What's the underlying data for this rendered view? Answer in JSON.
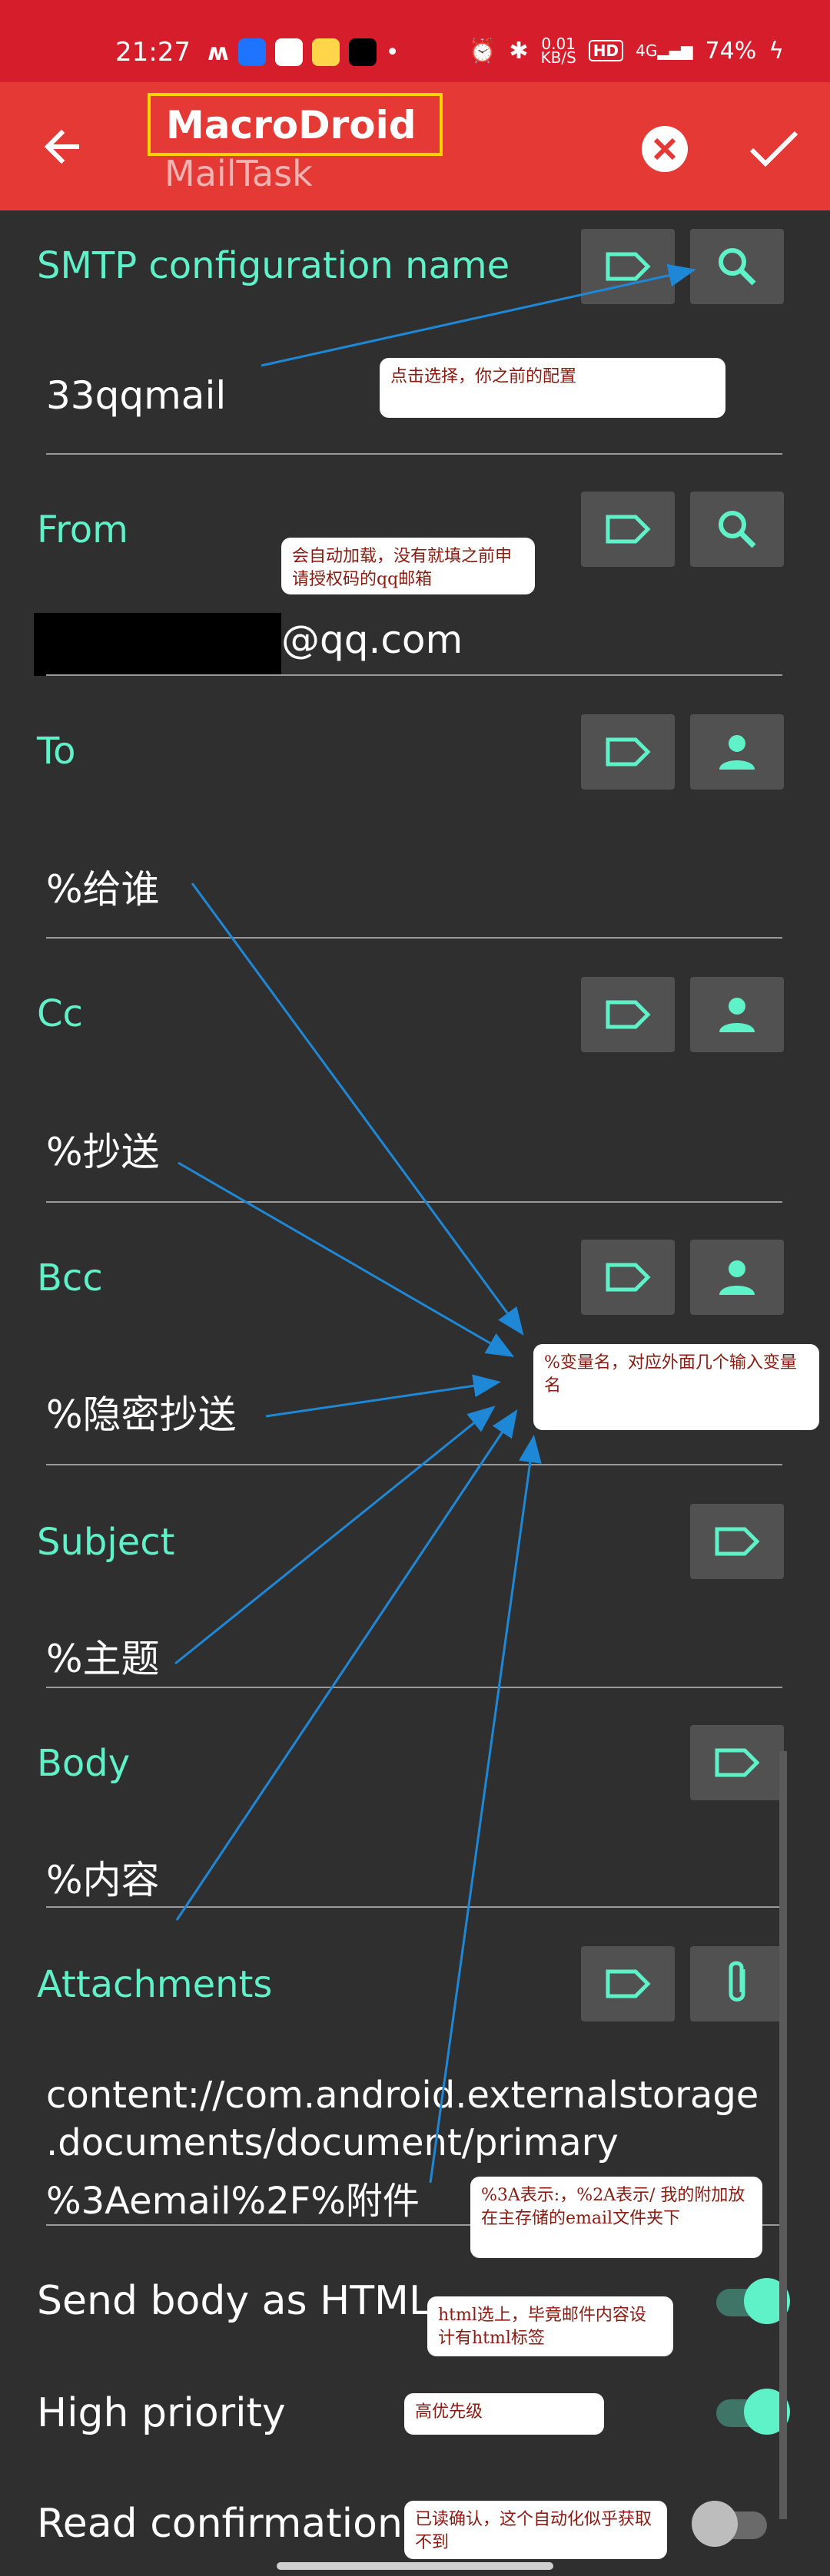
{
  "status_bar": {
    "time": "21:27",
    "net_speed_value": "0.01",
    "net_speed_unit": "KB/S",
    "hd": "HD",
    "signal": "4G",
    "battery": "74%"
  },
  "toolbar": {
    "title": "MacroDroid",
    "subtitle": "MailTask"
  },
  "fields": {
    "smtp": {
      "label": "SMTP configuration name",
      "value": "33qqmail"
    },
    "from": {
      "label": "From",
      "value": "@qq.com"
    },
    "to": {
      "label": "To",
      "value": "%给谁"
    },
    "cc": {
      "label": "Cc",
      "value": "%抄送"
    },
    "bcc": {
      "label": "Bcc",
      "value": "%隐密抄送"
    },
    "subject": {
      "label": "Subject",
      "value": "%主题"
    },
    "body": {
      "label": "Body",
      "value": "%内容"
    },
    "attachments": {
      "label": "Attachments",
      "line1": "content://com.android.externalstorage",
      "line2": ".documents/document/primary",
      "line3": "%3Aemail%2F%附件"
    }
  },
  "toggles": {
    "html": {
      "label": "Send body as HTML",
      "on": true
    },
    "priority": {
      "label": "High priority",
      "on": true
    },
    "read": {
      "label": "Read confirmation",
      "on": false
    }
  },
  "notes": {
    "smtp": "点击选择，你之前的配置",
    "from": "会自动加载，没有就填之前申请授权码的qq邮箱",
    "varname": "%变量名，对应外面几个输入变量名",
    "attach": "%3A表示:，%2A表示/ 我的附加放在主存储的email文件夹下",
    "html": "html选上，毕竟邮件内容设计有html标签",
    "priority": "高优先级",
    "read": "已读确认，这个自动化似乎获取不到"
  },
  "colors": {
    "status_bar": "#d61d2b",
    "toolbar": "#e53935",
    "accent": "#5ff1c8",
    "background": "#2f2f2f",
    "arrow": "#1e88d6"
  }
}
